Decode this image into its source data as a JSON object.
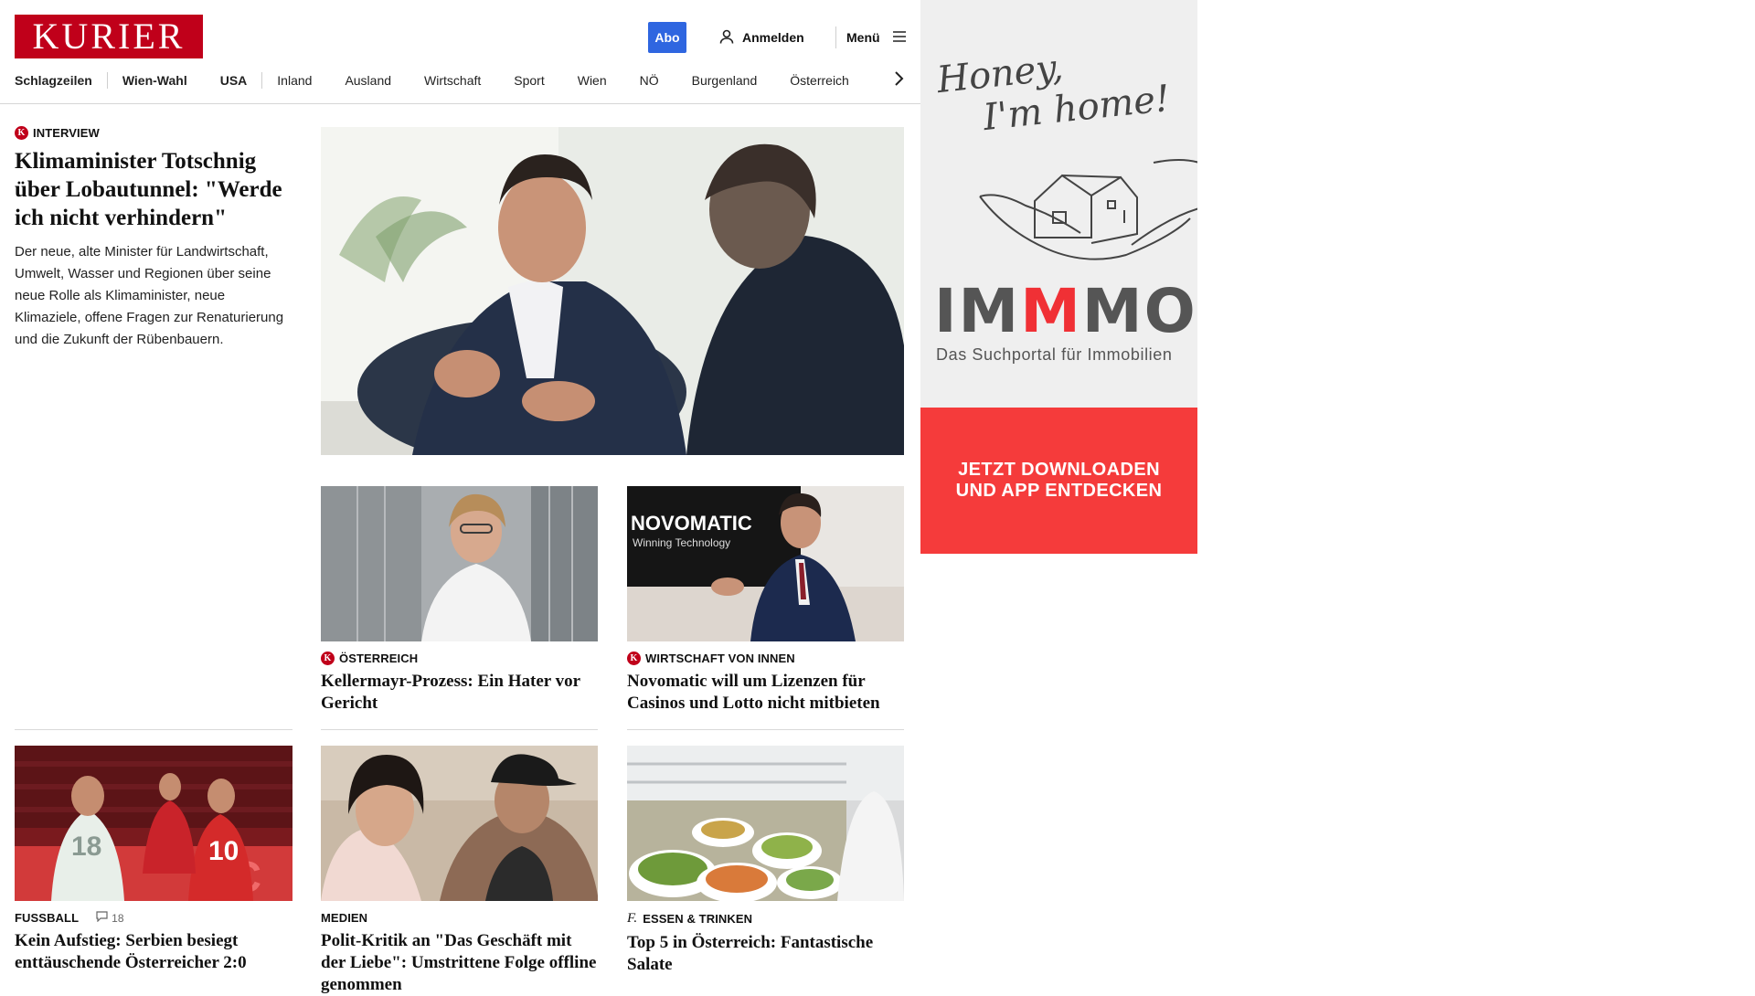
{
  "brand": {
    "logo_text": "KURIER",
    "color": "#c0001a"
  },
  "header": {
    "abo_label": "Abo",
    "login_label": "Anmelden",
    "menu_label": "Menü"
  },
  "nav": {
    "items": [
      "Schlagzeilen",
      "Wien-Wahl",
      "USA",
      "Inland",
      "Ausland",
      "Wirtschaft",
      "Sport",
      "Wien",
      "NÖ",
      "Burgenland",
      "Österreich"
    ],
    "next_icon": "chevron-right-icon"
  },
  "lead": {
    "kicker": "INTERVIEW",
    "title": "Klimaminister Totschnig über Lobautunnel: \"Werde ich nicht verhindern\"",
    "description": "Der neue, alte Minister für Landwirtschaft, Umwelt, Wasser und Regionen über seine neue Rolle als Klimaminister, neue Klimaziele, offene Fragen zur Renaturierung und die Zukunft der Rübenbauern."
  },
  "cards": [
    {
      "kicker": "ÖSTERREICH",
      "title": "Kellermayr-Prozess: Ein Hater vor Gericht",
      "badge": "kurier-plus-icon"
    },
    {
      "kicker": "WIRTSCHAFT VON INNEN",
      "title": "Novomatic will um Lizenzen für Casinos und Lotto nicht mitbieten",
      "badge": "kurier-plus-icon",
      "photo_text": {
        "brand": "NOVOMATIC",
        "sub": "Winning Technology"
      }
    },
    {
      "kicker": "FUSSBALL",
      "title": "Kein Aufstieg: Serbien besiegt enttäuschende Österreicher 2:0",
      "comments": "18",
      "photo_text": {
        "n1": "18",
        "n2": "10"
      }
    },
    {
      "kicker": "MEDIEN",
      "title": "Polit-Kritik an \"Das Geschäft mit der Liebe\": Umstrittene Folge offline genommen"
    },
    {
      "kicker": "ESSEN & TRINKEN",
      "title": "Top 5 in Österreich: Fantastische Salate",
      "badge": "f-icon"
    }
  ],
  "ad": {
    "script_line1": "Honey,",
    "script_line2": "I'm home!",
    "brand_a": "IM",
    "brand_m": "M",
    "brand_b": "MO",
    "tagline": "Das Suchportal für Immobilien",
    "cta": "JETZT DOWNLOADEN UND APP ENTDECKEN",
    "accent": "#f03035"
  }
}
